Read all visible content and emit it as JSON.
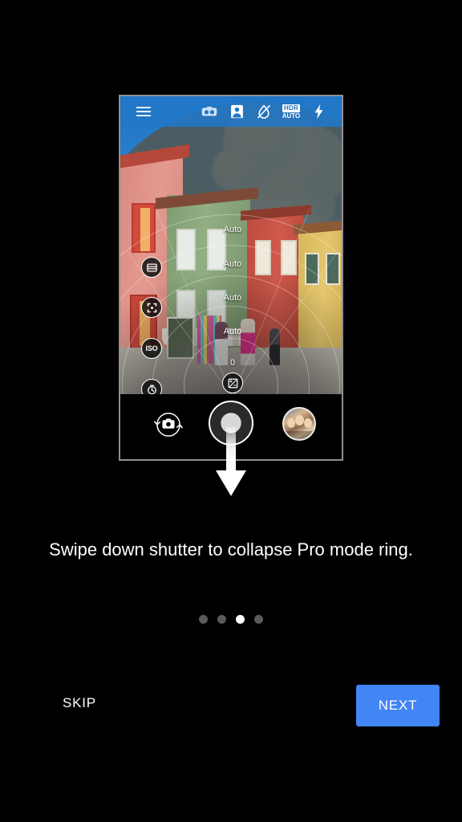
{
  "screen": {
    "background_color": "#000000",
    "accent_color": "#4285F4"
  },
  "phone_preview": {
    "camera_topbar": {
      "menu_icon": "hamburger-menu-icon",
      "items": [
        {
          "icon": "dual-camera-icon",
          "label": "Dual camera"
        },
        {
          "icon": "portrait-mode-icon",
          "label": "Portrait"
        },
        {
          "icon": "beautify-off-icon",
          "label": "Beautification off"
        },
        {
          "icon": "hdr-auto-icon",
          "label_top": "HDR",
          "label_bottom": "AUTO"
        },
        {
          "icon": "flash-icon",
          "label": "Flash"
        }
      ]
    },
    "pro_ring": {
      "controls": [
        {
          "icon": "white-balance-icon",
          "name": "white-balance",
          "value": "Auto"
        },
        {
          "icon": "focus-icon",
          "name": "focus",
          "value": "Auto"
        },
        {
          "icon": "iso-icon",
          "name": "iso",
          "label": "ISO",
          "value": "Auto"
        },
        {
          "icon": "shutter-speed-icon",
          "name": "shutter-speed",
          "value": "Auto"
        },
        {
          "icon": "exposure-compensation-icon",
          "name": "exposure-compensation",
          "value": "0"
        }
      ]
    },
    "camera_controls": {
      "switch_camera_icon": "switch-camera-icon",
      "shutter_label": "Shutter",
      "gallery_label": "Gallery thumbnail"
    },
    "gesture_hint_icon": "swipe-down-arrow-icon"
  },
  "tutorial": {
    "caption": "Swipe down shutter to collapse Pro mode ring.",
    "pagination": {
      "total": 4,
      "active_index": 2
    },
    "skip_label": "SKIP",
    "next_label": "NEXT"
  }
}
